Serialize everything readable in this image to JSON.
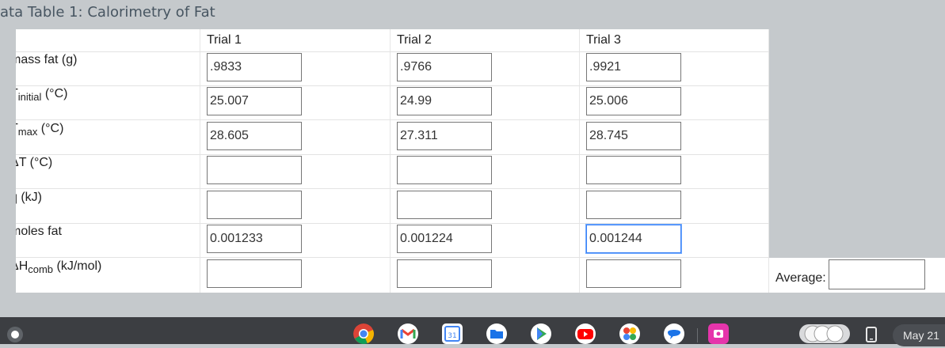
{
  "title": "ata Table 1: Calorimetry of Fat",
  "table": {
    "headers": [
      "Trial 1",
      "Trial 2",
      "Trial 3"
    ],
    "rows": [
      {
        "label": "mass fat (g)",
        "values": [
          ".9833",
          ".9766",
          ".9921"
        ]
      },
      {
        "label_main": "T",
        "label_sub": "initial",
        "label_unit": " (°C)",
        "values": [
          "25.007",
          "24.99",
          "25.006"
        ]
      },
      {
        "label_main": "T",
        "label_sub": "max",
        "label_unit": " (°C)",
        "values": [
          "28.605",
          "27.311",
          "28.745"
        ]
      },
      {
        "label": "ΔT (°C)",
        "values": [
          "",
          "",
          ""
        ]
      },
      {
        "label": "q (kJ)",
        "values": [
          "",
          "",
          ""
        ]
      },
      {
        "label": "moles fat",
        "values": [
          "0.001233",
          "0.001224",
          "0.001244"
        ]
      },
      {
        "label_main": "ΔH",
        "label_sub": "comb",
        "label_unit": " (kJ/mol)",
        "values": [
          "",
          "",
          ""
        ]
      }
    ],
    "average_label": "Average:",
    "average_value": ""
  },
  "taskbar": {
    "date": "May 21",
    "apps": [
      "chrome-icon",
      "gmail-icon",
      "calendar-icon",
      "files-icon",
      "play-store-icon",
      "youtube-icon",
      "photos-icon",
      "messages-icon",
      "screencast-icon"
    ],
    "calendar_day": "31"
  }
}
